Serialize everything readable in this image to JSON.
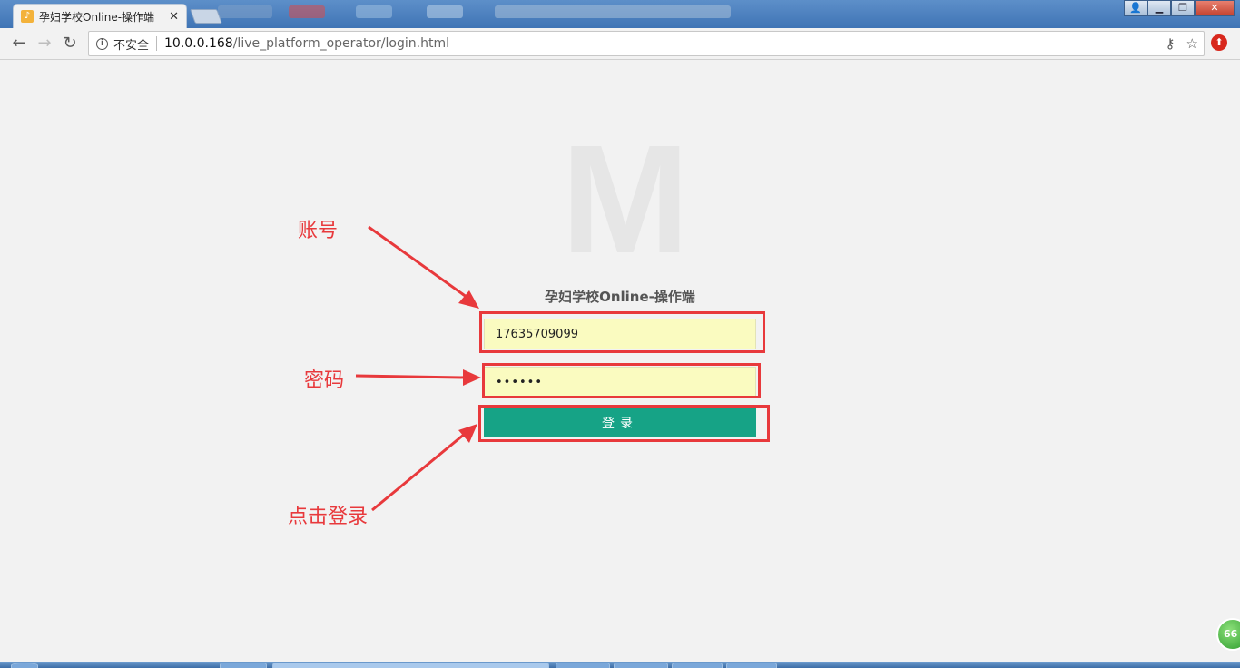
{
  "browser": {
    "tab_title": "孕妇学校Online-操作端",
    "tab_favicon_glyph": "♪",
    "security_label": "不安全",
    "url_host": "10.0.0.168",
    "url_path": "/live_platform_operator/login.html"
  },
  "page": {
    "logo_letter": "M",
    "app_title": "孕妇学校Online-操作端",
    "account_value": "17635709099",
    "password_value": "••••••",
    "login_label": "登录"
  },
  "annotations": {
    "account_note": "账号",
    "password_note": "密码",
    "login_note": "点击登录",
    "color": "#e8393c"
  },
  "colors": {
    "login_button": "#16a386",
    "input_autofill": "#fafbc0",
    "page_background": "#f2f2f2"
  },
  "taskbar": {
    "badge_text": "66"
  }
}
